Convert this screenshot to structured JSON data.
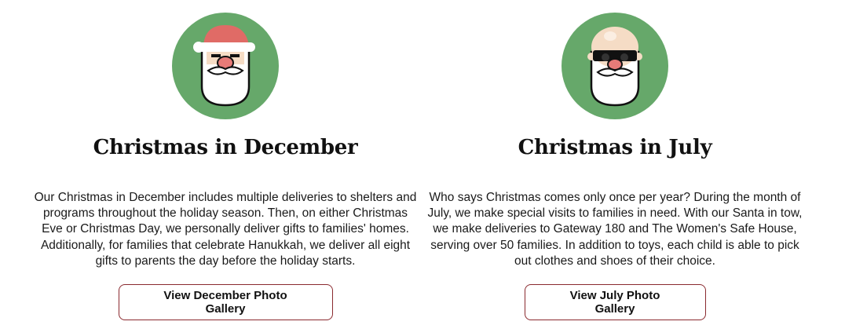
{
  "sections": [
    {
      "title": "Christmas in December",
      "description": "Our Christmas in December includes multiple deliveries to shelters and programs throughout the holiday season. Then, on either Christmas Eve or Christmas Day, we personally deliver gifts to families' homes. Additionally, for families that celebrate Hanukkah, we deliver all eight gifts to parents the day before the holiday starts.",
      "button_label": "View December Photo Gallery",
      "icon": "santa-hat-icon"
    },
    {
      "title": "Christmas in July",
      "description": "Who says Christmas comes only once per year? During the month of July, we make special visits to families in need. With our Santa in tow, we make deliveries to Gateway 180 and The Women's Safe House, serving over 50 families. In addition to toys, each child is able to pick out clothes and shoes of their choice.",
      "button_label": "View July Photo Gallery",
      "icon": "santa-sunglasses-icon"
    }
  ],
  "colors": {
    "circle_green": "#66a86a",
    "hat_red": "#e06b66",
    "button_border": "#8a2a2f",
    "skin_pale": "#f5dcc5"
  }
}
